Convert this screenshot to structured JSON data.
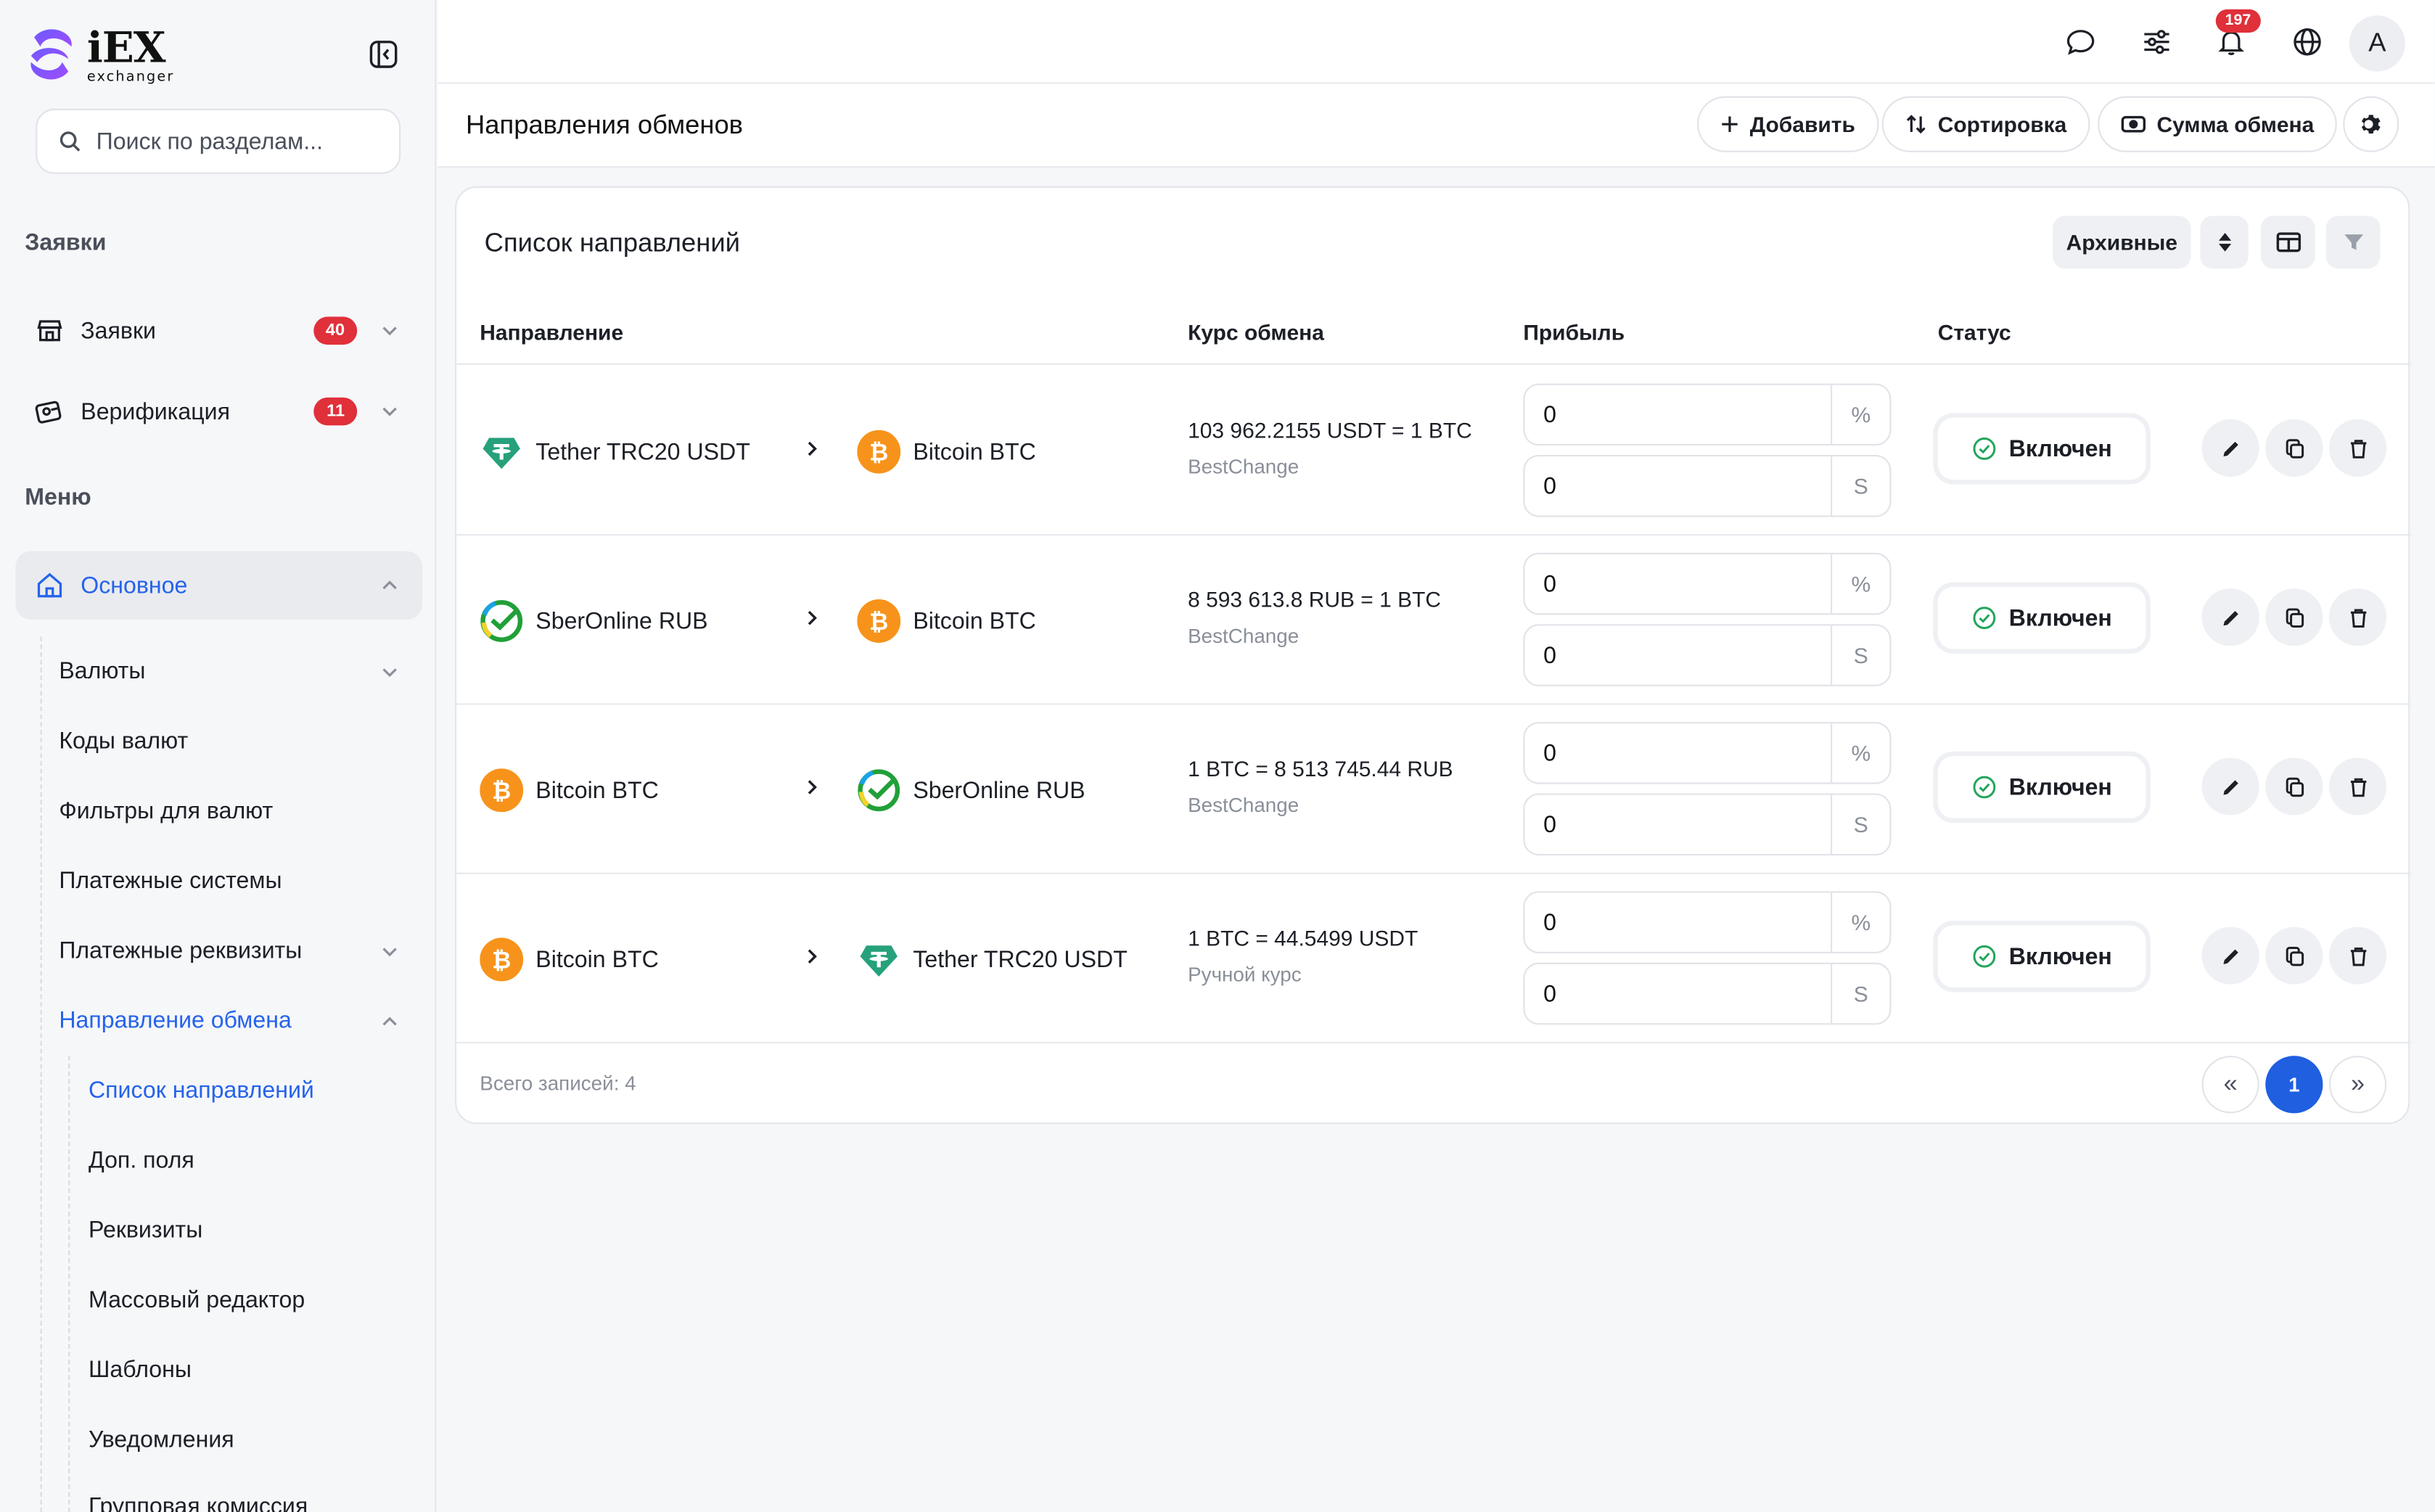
{
  "brand": {
    "name": "iEX",
    "subtitle": "exchanger"
  },
  "search": {
    "placeholder": "Поиск по разделам..."
  },
  "sidebar": {
    "section_orders": "Заявки",
    "section_menu": "Меню",
    "orders_items": [
      {
        "label": "Заявки",
        "badge": "40"
      },
      {
        "label": "Верификация",
        "badge": "11"
      }
    ],
    "main_item": "Основное",
    "sub_items": [
      "Валюты",
      "Коды валют",
      "Фильтры для валют",
      "Платежные системы",
      "Платежные реквизиты",
      "Направление обмена"
    ],
    "subsub_items": [
      "Список направлений",
      "Доп. поля",
      "Реквизиты",
      "Массовый редактор",
      "Шаблоны",
      "Уведомления",
      "Групповая комиссия"
    ]
  },
  "topbar": {
    "notifications_count": "197",
    "avatar_letter": "A"
  },
  "page": {
    "title": "Направления обменов",
    "buttons": {
      "add": "Добавить",
      "sort": "Сортировка",
      "amount": "Сумма обмена"
    }
  },
  "card": {
    "title": "Список направлений",
    "archive_button": "Архивные",
    "columns": {
      "direction": "Направление",
      "rate": "Курс обмена",
      "profit": "Прибыль",
      "status": "Статус"
    },
    "rows": [
      {
        "from": "Tether TRC20 USDT",
        "from_icon": "tether-icon",
        "to": "Bitcoin BTC",
        "to_icon": "bitcoin-icon",
        "rate": "103 962.2155 USDT = 1 BTC",
        "source": "BestChange",
        "profit_percent": "0",
        "profit_fixed": "0",
        "status": "Включен"
      },
      {
        "from": "SberOnline RUB",
        "from_icon": "sber-icon",
        "to": "Bitcoin BTC",
        "to_icon": "bitcoin-icon",
        "rate": "8 593 613.8 RUB = 1 BTC",
        "source": "BestChange",
        "profit_percent": "0",
        "profit_fixed": "0",
        "status": "Включен"
      },
      {
        "from": "Bitcoin BTC",
        "from_icon": "bitcoin-icon",
        "to": "SberOnline RUB",
        "to_icon": "sber-icon",
        "rate": "1 BTC = 8 513 745.44 RUB",
        "source": "BestChange",
        "profit_percent": "0",
        "profit_fixed": "0",
        "status": "Включен"
      },
      {
        "from": "Bitcoin BTC",
        "from_icon": "bitcoin-icon",
        "to": "Tether TRC20 USDT",
        "to_icon": "tether-icon",
        "rate": "1 BTC = 44.5499 USDT",
        "source": "Ручной курс",
        "profit_percent": "0",
        "profit_fixed": "0",
        "status": "Включен"
      }
    ],
    "suffix_percent": "%",
    "suffix_fixed": "S",
    "total": "Всего записей: 4",
    "pagination": {
      "prev": "«",
      "current": "1",
      "next": "»"
    }
  },
  "colors": {
    "accent": "#2563eb",
    "badge": "#e0303a",
    "bitcoin": "#f7931a",
    "tether": "#26a17b",
    "success": "#22a55b"
  }
}
